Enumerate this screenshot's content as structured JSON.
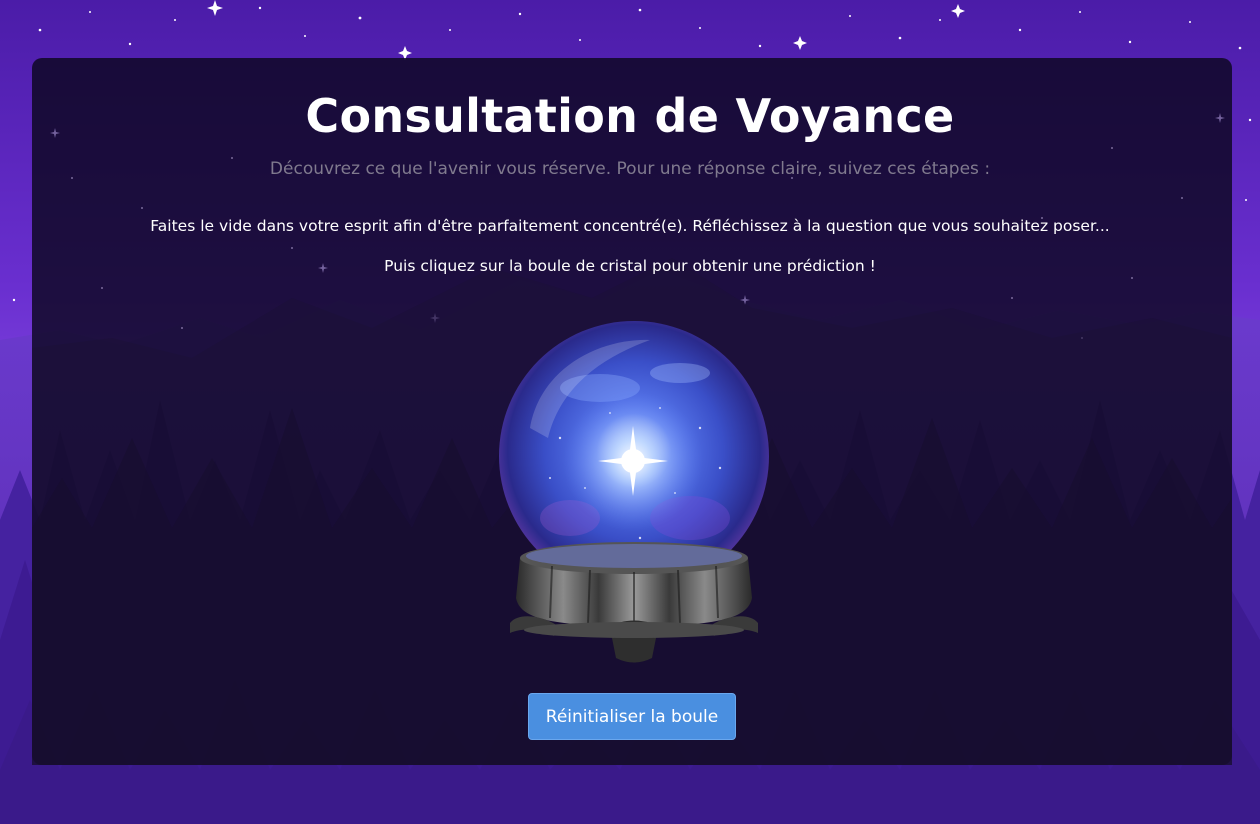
{
  "page": {
    "title": "Consultation de Voyance",
    "subtitle": "Découvrez ce que l'avenir vous réserve. Pour une réponse claire, suivez ces étapes :",
    "instruction_1": "Faites le vide dans votre esprit afin d'être parfaitement concentré(e). Réfléchissez à la question que vous souhaitez poser...",
    "instruction_2": "Puis cliquez sur la boule de cristal pour obtenir une prédiction !"
  },
  "crystal_ball": {
    "icon": "crystal-ball-icon"
  },
  "actions": {
    "reset_label": "Réinitialiser la boule"
  },
  "colors": {
    "sky_top": "#4a1aa8",
    "sky_bottom": "#8a4fe0",
    "panel": "#0a061c",
    "button": "#4a8fe0",
    "subtitle": "#807a8e"
  }
}
